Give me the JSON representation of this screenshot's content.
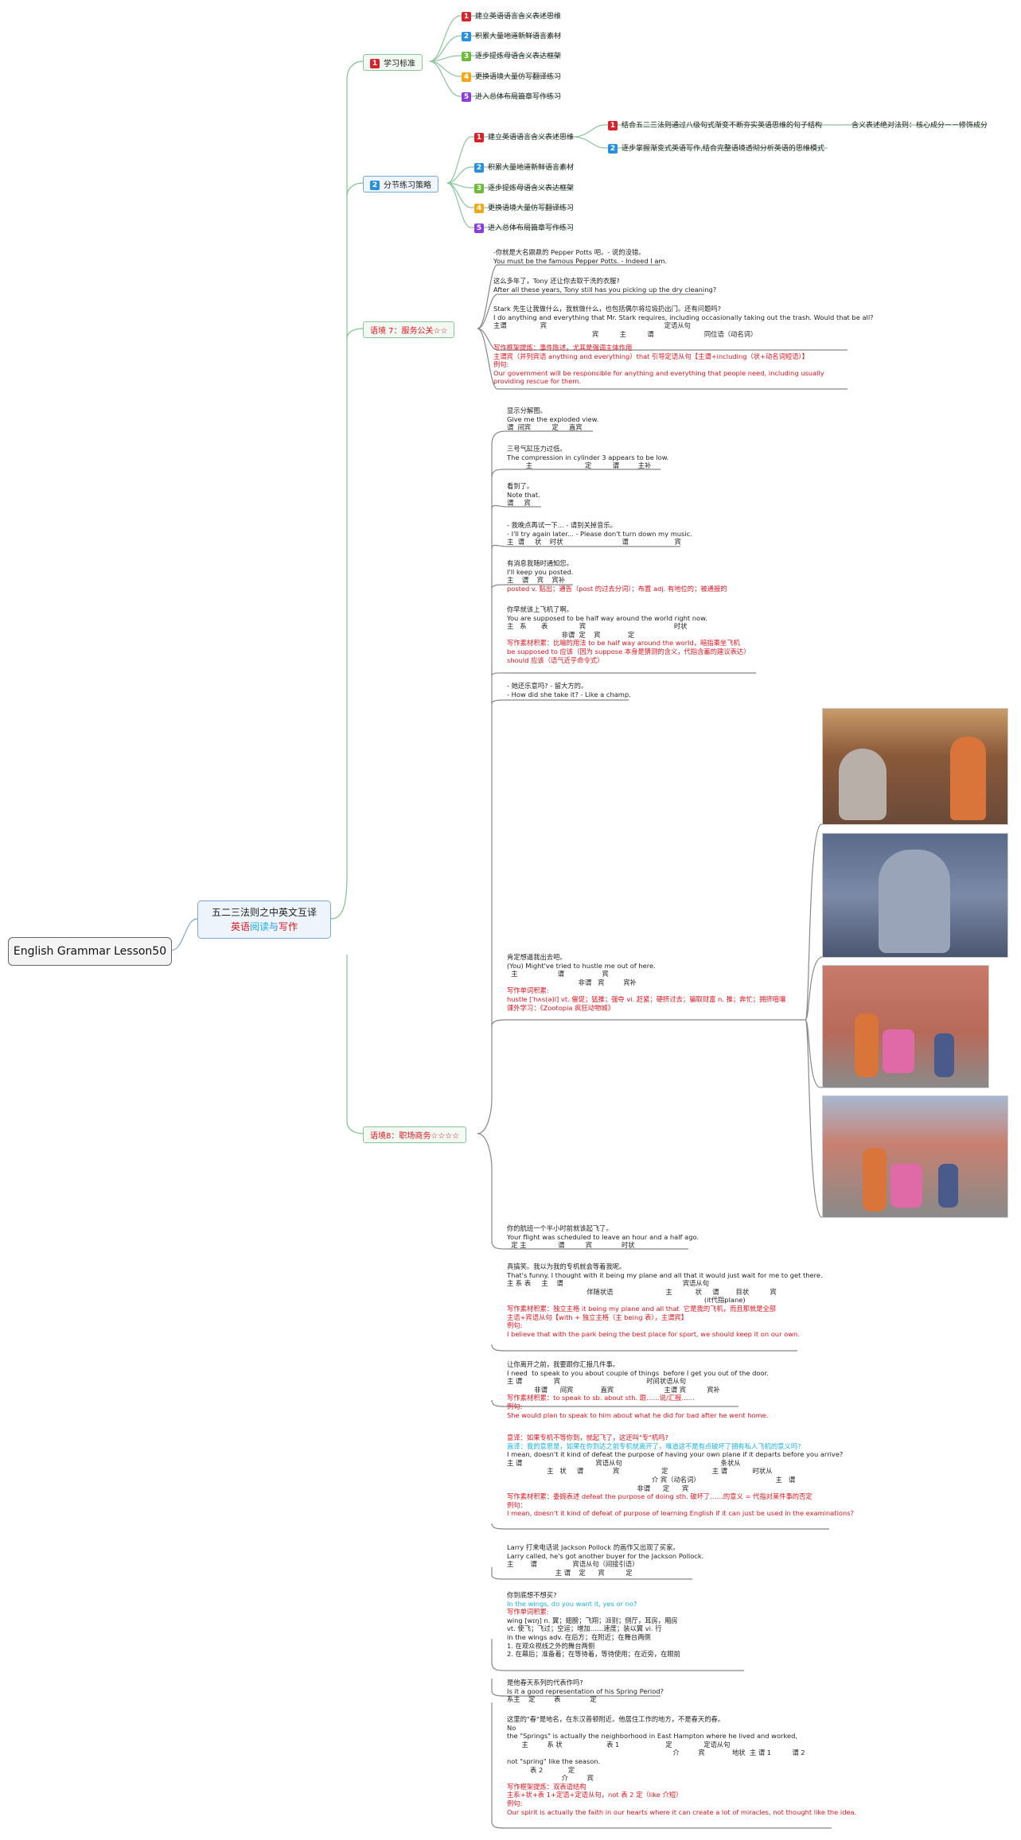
{
  "root": {
    "title": "English Grammar Lesson50"
  },
  "main": {
    "line1": "五二三法则之中英文互译",
    "part_a": "英语",
    "part_b": "阅读",
    "part_c": "与",
    "part_d": "写作"
  },
  "sec1": {
    "num": "1",
    "label": "学习标准",
    "items": [
      "建立英语语言含义表述思维",
      "积累大量地道新鲜语言素材",
      "逐步提炼母语含义表达框架",
      "更换语境大量仿写翻译练习",
      "进入总体布局篇章写作练习"
    ]
  },
  "sec2": {
    "num": "2",
    "label": "分节练习策略",
    "items": [
      "建立英语语言含义表述思维",
      "积累大量地道新鲜语言素材",
      "逐步提炼母语含义表达框架",
      "更换语境大量仿写翻译练习",
      "进入总体布局篇章写作练习"
    ],
    "sub": [
      "结合五二三法则通过八级句式渐变不断夯实英语思维的句子结构",
      "逐步掌握渐变式英语写作,结合完整语境透彻分析英语的思维模式"
    ],
    "sub_note": "含义表述绝对法则：核心成分－－修饰成分"
  },
  "sec7": {
    "label": "语境 7：服务公关☆☆",
    "blocks": [
      [
        "-你就是大名鼎鼎的 Pepper Potts 吧。- 说的没错。",
        "You must be the famous Pepper Potts. - Indeed I am."
      ],
      [
        "这么多年了，Tony 还让你去取干洗的衣服?",
        "After all these years, Tony still has you picking up the dry cleaning?"
      ],
      [
        "Stark 先生让我做什么，我就做什么，也包括偶尔将垃圾扔出门。还有问题吗?",
        "I do anything and everything that Mr. Stark requires, including occasionally taking out the trash. Would that be all?",
        "主谓                宾                                                        定语从句",
        "                                               宾          主          谓                        同位语（动名词）"
      ],
      [
        "写作框架提炼：事件陈述，尤其是强调主体作用",
        "主谓宾（并列宾语 anything and everything）that 引导定语从句【主谓+including（状+动名词短语）】",
        "例句:",
        "Our government will be responsible for anything and everything that people need, including usually",
        "providing rescue for them."
      ]
    ]
  },
  "sec8": {
    "label": "语境8：职场商务☆☆☆☆",
    "blocks": [
      [
        "显示分解图。",
        "Give me the exploded view.",
        "谓  间宾          定     直宾"
      ],
      [
        "三号气缸压力过低。",
        "The compression in cylinder 3 appears to be low.",
        "         主                         定          谓         主补"
      ],
      [
        "看到了。",
        "Note that.",
        "谓     宾"
      ],
      [
        "- 我晚点再试一下... - 请别关掉音乐。",
        "- I'll try again later... - Please don't turn down my music.",
        "主  谓     状    时状                            谓                      宾"
      ],
      [
        "有消息我随时通知您。",
        "I'll keep you posted.",
        "主    谓    宾    宾补",
        "posted v. 贴出；通告（post 的过去分词）；布置 adj. 有地位的；被通报的"
      ],
      [
        "你早就该上飞机了啊。",
        "You are supposed to be half way around the world right now.",
        "主   系       表               宾                                          时状",
        "                          非谓  定    宾             定",
        "写作素材积累：比喻的用法 to be half way around the world，暗指乘坐飞机",
        "be supposed to 应该（因为 suppose 本身是猜测的含义，代指含蓄的建议表达）",
        "should 应该（语气近乎命令式）"
      ],
      [
        "- 她还乐意吗? - 留大方的。",
        "- How did she take it? - Like a champ."
      ],
      [
        "肯定想逼我出去吧。",
        "(You) Might've tried to hustle me out of here.",
        "  主                   谓                  宾",
        "                                  非谓   宾         宾补",
        "写作单词积累:",
        "hustle [ˈhʌs(ə)l] vt. 催促；猛推；强夺 vi. 赶紧；硬挤过去；骗取财富 n. 推；奔忙；拥挤喧嚷",
        "课外学习：《Zootopia 疯狂动物城》"
      ],
      [
        "你的航班一个半小时前就该起飞了。",
        "Your flight was scheduled to leave an hour and a half ago.",
        "  定 主               谓          宾              时状"
      ],
      [
        "真搞笑。我以为我的专机就会等着我呢。",
        "That's funny. I thought with it being my plane and all that it would just wait for me to get there.",
        "主 系 表     主    谓                                                         宾语从句",
        "                                      伴随状语                         主           状     谓        目状          宾",
        "                                                                                              (it代指plane)",
        "写作素材积累：独立主格 it being my plane and all that  它是我的飞机，而且那就是全部",
        "主语+宾语从句【with + 独立主格（主 being 表），主谓宾】",
        "例句:",
        "I believe that with the park being the best place for sport, we should keep it on our own."
      ],
      [
        "让你离开之前，我要跟你汇报几件事。",
        "I need  to speak to you about couple of things  before I get you out of the door.",
        "主 谓               宾                                         时间状语从句",
        "             非谓      间宾             直宾                        主谓 宾          宾补",
        "写作素材积累：to speak to sb. about sth. 跟……说/汇报……",
        "例句:",
        "She would plan to speak to him about what he did for bad after he went home."
      ],
      [
        "意译：如果专机不等你到，就起飞了，这还叫\"专\"机吗?",
        "直译：我的意思是，如果在你到达之前专机就离开了，难道这不是有点破坏了拥有私人飞机的意义吗?",
        "I mean, doesn't it kind of defeat the purpose of having your own plane if it departs before you arrive?",
        "主 谓                                   宾语从句                                               条状从",
        "                   主   状     谓              宾                    定                     主 谓            时状从",
        "                                                                     介 宾（动名词）                                    主   谓",
        "                                                              非谓      定      宾",
        "写作素材积累：委婉表述 defeat the purpose of doing sth. 破坏了……的意义 = 代指对某件事的否定",
        "例句：",
        "I mean, doesn't it kind of defeat of purpose of learning English if it can just be used in the examinations?"
      ],
      [
        "Larry 打来电话说 Jackson Pollock 的画作又出现了买家。",
        "Larry called, he's got another buyer for the Jackson Pollock.",
        "主        谓                 宾语从句（间接引语）",
        "                       主 谓    定      宾          定"
      ],
      [
        "你到底想不想买?",
        "In the wings, do you want it, yes or no?",
        "写作单词积累:",
        "wing [wɪŋ] n. 翼；翅膀；飞翔；派别；侧厅，耳房，厢房",
        "vt. 使飞；飞过；空运；增加……速度；装以翼 vi. 行",
        "in the wings adv. 在后方；在附近；在舞台两侧",
        "1. 在观众视线之外的舞台两侧",
        "2. 在幕后；准备着；在等待着，等待使用；在近旁，在眼前"
      ],
      [
        "是他春天系列的代表作吗?",
        "Is it a good representation of his Spring Period?",
        "系主    定         表              定"
      ],
      [
        "这里的\"春\"是地名，在东汉普顿附近。他居住工作的地方，不是春天的春。",
        "No",
        "the \"Springs\" is actually the neighborhood in East Hampton where he lived and worked,",
        "       主         系 状                     表 1                      定               定语从句",
        "                                                                               介         宾             地状  主 谓 1          谓 2",
        "not \"spring\" like the season.",
        "           表 2            定",
        "                          介         宾",
        "写作框架提炼：双表语结构",
        "主系+状+表 1+定语+定语从句，not 表 2 定（like 介短）",
        "例句:",
        "Our spirit is actually the faith in our hearts where it can create a lot of miracles, not thought like the idea."
      ]
    ]
  },
  "colors": {
    "green_line": "#7bc48a",
    "blue_line": "#7aa7d6",
    "gray_line": "#888888",
    "red": "#e0141e",
    "cyan": "#16b2e6"
  }
}
